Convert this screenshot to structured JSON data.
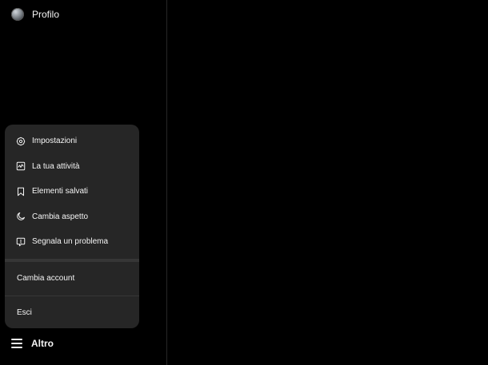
{
  "sidebar": {
    "profile": {
      "label": "Profilo",
      "icon": "avatar"
    },
    "more": {
      "label": "Altro",
      "icon": "hamburger-icon"
    }
  },
  "menu": {
    "items": [
      {
        "label": "Impostazioni",
        "icon": "settings-icon"
      },
      {
        "label": "La tua attività",
        "icon": "activity-icon"
      },
      {
        "label": "Elementi salvati",
        "icon": "bookmark-icon"
      },
      {
        "label": "Cambia aspetto",
        "icon": "moon-icon"
      },
      {
        "label": "Segnala un problema",
        "icon": "report-icon"
      }
    ],
    "switch_account": "Cambia account",
    "logout": "Esci"
  },
  "colors": {
    "background": "#000000",
    "menu_background": "#262626",
    "separator": "#363636",
    "text": "#f5f5f5"
  }
}
